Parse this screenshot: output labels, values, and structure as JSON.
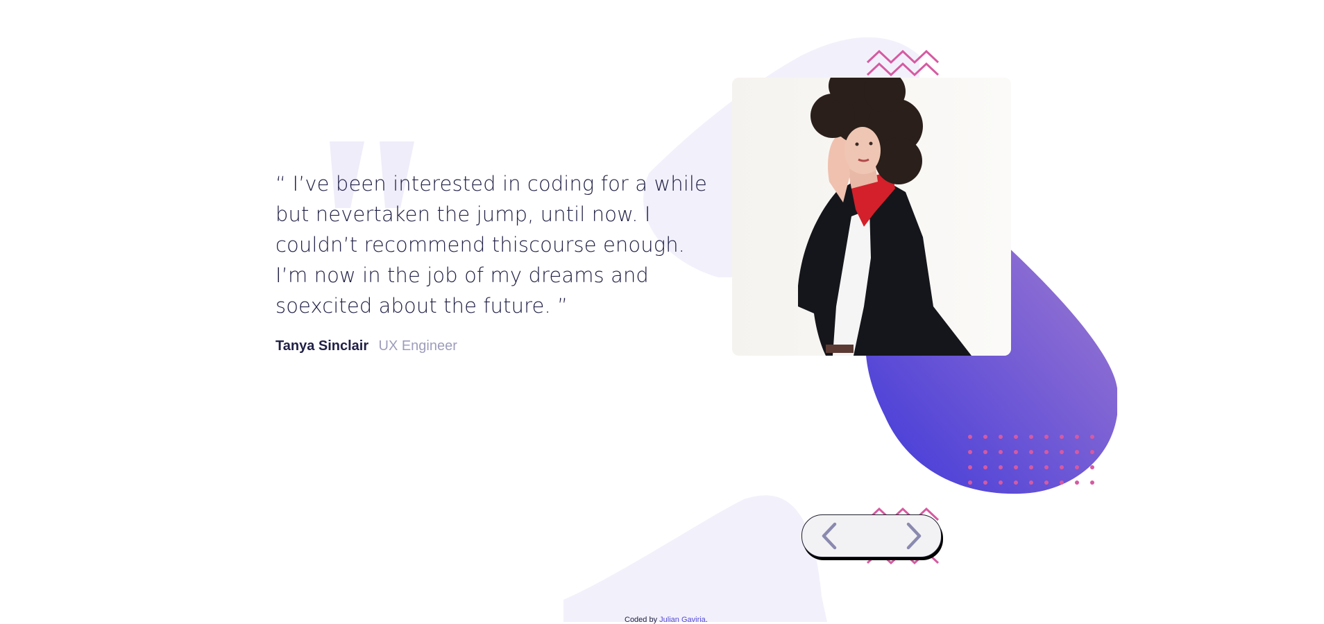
{
  "testimonial": {
    "quote": "“ I’ve been interested in coding for a while but nevertaken the jump, until now. I couldn’t recommend thiscourse enough. I’m now in the job of my dreams and soexcited about the future. ”",
    "author_name": "Tanya Sinclair",
    "author_role": "UX Engineer"
  },
  "photo": {
    "alt": "Portrait of Tanya Sinclair"
  },
  "navigation": {
    "prev_icon": "chevron-left-icon",
    "next_icon": "chevron-right-icon"
  },
  "footer": {
    "prefix": "Coded by",
    "author_link": "Julian Gaviria",
    "suffix": "."
  },
  "colors": {
    "text_dark": "#202046",
    "text_muted": "#9d9dbc",
    "blob_start": "#4c41d8",
    "blob_end": "#9472d2",
    "pattern_pink": "#d65aa1",
    "bg_curve": "#f2f1fb",
    "arrow_color": "#8a8ab0"
  }
}
